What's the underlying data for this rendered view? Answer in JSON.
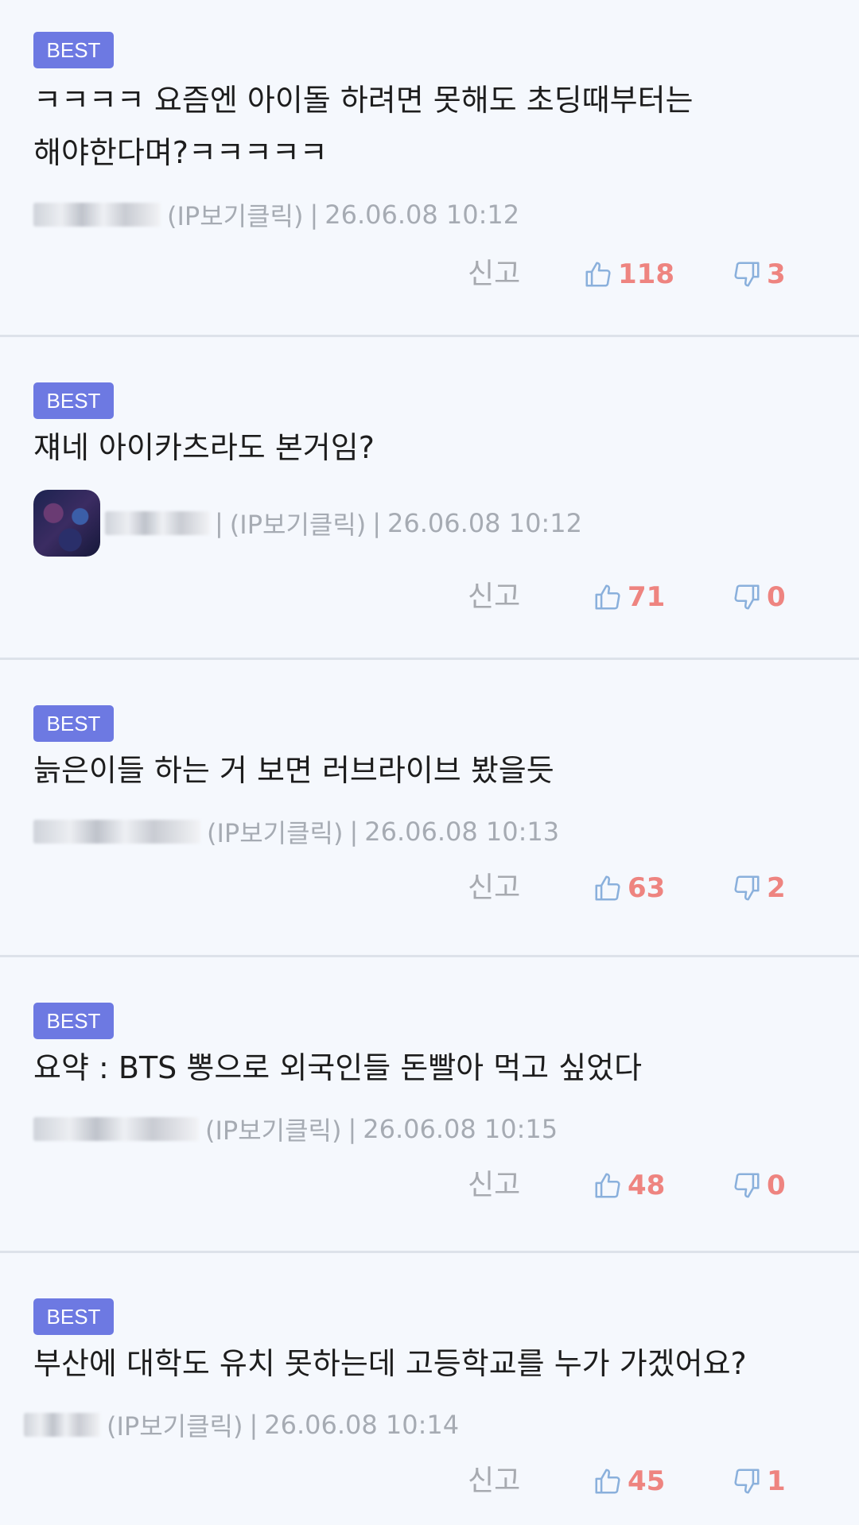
{
  "comments": [
    {
      "badge": "BEST",
      "text": "ㅋㅋㅋㅋ 요즘엔 아이돌 하려면 못해도 초딩때부터는 해야한다며?ㅋㅋㅋㅋㅋ",
      "ip_label": "(IP보기클릭)",
      "datetime": "26.06.08 10:12",
      "report": "신고",
      "likes": "118",
      "dislikes": "3"
    },
    {
      "badge": "BEST",
      "text": "쟤네 아이카츠라도 본거임?",
      "ip_label": "(IP보기클릭)",
      "datetime": "26.06.08 10:12",
      "report": "신고",
      "likes": "71",
      "dislikes": "0"
    },
    {
      "badge": "BEST",
      "text": "늙은이들 하는 거 보면 러브라이브 봤을듯",
      "ip_label": "(IP보기클릭)",
      "datetime": "26.06.08 10:13",
      "report": "신고",
      "likes": "63",
      "dislikes": "2"
    },
    {
      "badge": "BEST",
      "text": "요약 : BTS 뽕으로 외국인들 돈빨아 먹고 싶었다",
      "ip_label": "(IP보기클릭)",
      "datetime": "26.06.08 10:15",
      "report": "신고",
      "likes": "48",
      "dislikes": "0"
    },
    {
      "badge": "BEST",
      "text": "부산에 대학도 유치 못하는데 고등학교를 누가 가겠어요?",
      "ip_label": "(IP보기클릭)",
      "datetime": "26.06.08 10:14",
      "report": "신고",
      "likes": "45",
      "dislikes": "1"
    }
  ],
  "separator": "|",
  "colors": {
    "badge": "#6d79e2",
    "count": "#ee8480",
    "thumb": "#8ab0dc",
    "meta": "#a6abb3"
  },
  "icons": {
    "like": "thumbs-up-icon",
    "dislike": "thumbs-down-icon"
  }
}
